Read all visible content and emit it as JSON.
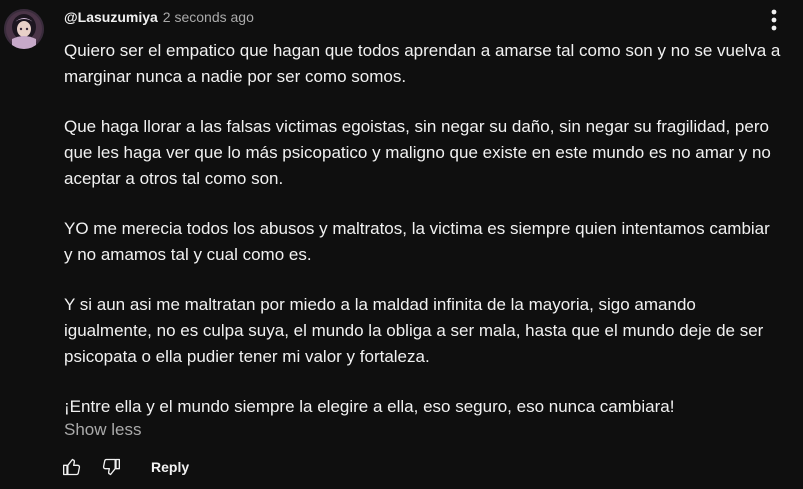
{
  "comment": {
    "author": "@Lasuzumiya",
    "timestamp": "2 seconds ago",
    "paragraphs": [
      [
        "Quiero ser el empatico que hagan que todos aprendan a amarse tal como son y no se vuelva a",
        "marginar nunca a nadie por ser como somos."
      ],
      [
        "Que haga llorar a las falsas victimas egoistas, sin negar su daño, sin negar su fragilidad, pero",
        "que les haga ver que lo más psicopatico y maligno que existe en este mundo es no amar y no",
        "aceptar a otros tal como son."
      ],
      [
        "YO me merecia todos los abusos y maltratos, la victima es siempre quien intentamos cambiar",
        "y no amamos tal y cual como es."
      ],
      [
        "Y si aun asi me maltratan por miedo a la maldad infinita de la mayoria, sigo amando",
        "igualmente, no es culpa suya, el mundo la obliga a ser mala, hasta que el mundo deje de ser",
        "psicopata o ella pudier tener mi valor y fortaleza."
      ],
      [
        "¡Entre ella y el mundo siempre la elegire a ella, eso seguro, eso nunca cambiara!"
      ]
    ],
    "show_less_label": "Show less",
    "reply_label": "Reply"
  },
  "icons": {
    "avatar": "avatar-image",
    "menu": "more-vert-icon",
    "like": "thumbs-up-icon",
    "dislike": "thumbs-down-icon"
  },
  "colors": {
    "background": "#0f0f0f",
    "text_primary": "#f1f1f1",
    "text_secondary": "#aaaaaa"
  }
}
